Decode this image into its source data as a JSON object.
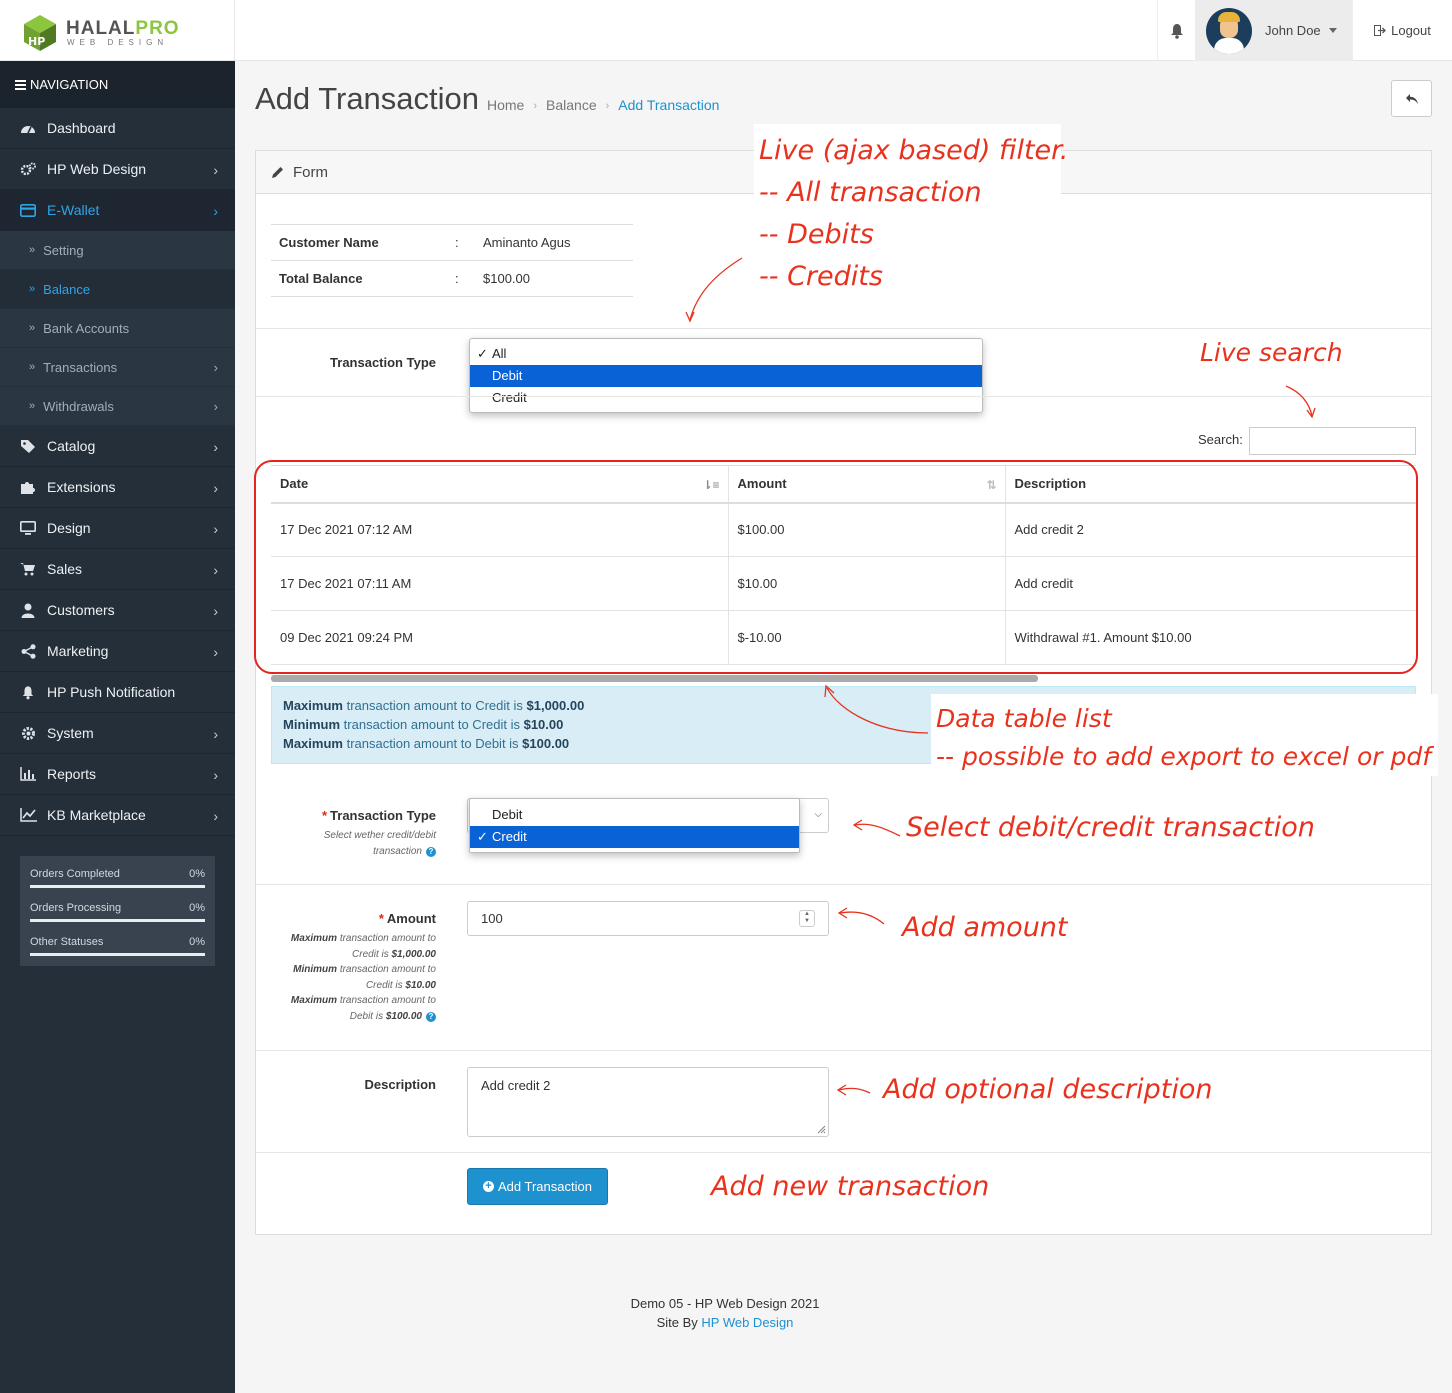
{
  "brand": {
    "name_part1": "HALAL",
    "name_part2": "PRO",
    "tagline": "WEB DESIGN"
  },
  "header": {
    "user_name": "John Doe",
    "logout_label": "Logout"
  },
  "sidebar": {
    "title": "NAVIGATION",
    "items": [
      {
        "label": "Dashboard",
        "icon": "dashboard-icon"
      },
      {
        "label": "HP Web Design",
        "icon": "cogs-icon"
      },
      {
        "label": "E-Wallet",
        "icon": "credit-card-icon"
      },
      {
        "label": "Catalog",
        "icon": "tags-icon"
      },
      {
        "label": "Extensions",
        "icon": "puzzle-icon"
      },
      {
        "label": "Design",
        "icon": "monitor-icon"
      },
      {
        "label": "Sales",
        "icon": "cart-icon"
      },
      {
        "label": "Customers",
        "icon": "user-icon"
      },
      {
        "label": "Marketing",
        "icon": "share-icon"
      },
      {
        "label": "HP Push Notification",
        "icon": "bell-icon"
      },
      {
        "label": "System",
        "icon": "gear-icon"
      },
      {
        "label": "Reports",
        "icon": "bar-chart-icon"
      },
      {
        "label": "KB Marketplace",
        "icon": "line-chart-icon"
      }
    ],
    "ewallet_sub": [
      {
        "label": "Setting"
      },
      {
        "label": "Balance"
      },
      {
        "label": "Bank Accounts"
      },
      {
        "label": "Transactions"
      },
      {
        "label": "Withdrawals"
      }
    ],
    "stats": [
      {
        "label": "Orders Completed",
        "value": "0%"
      },
      {
        "label": "Orders Processing",
        "value": "0%"
      },
      {
        "label": "Other Statuses",
        "value": "0%"
      }
    ]
  },
  "page": {
    "title": "Add Transaction",
    "breadcrumb": [
      "Home",
      "Balance",
      "Add Transaction"
    ],
    "panel_title": "Form"
  },
  "customer": {
    "name_label": "Customer Name",
    "name_value": "Aminanto Agus",
    "balance_label": "Total Balance",
    "balance_value": "$100.00",
    "colon": ":"
  },
  "filter": {
    "label": "Transaction Type",
    "options": [
      "All",
      "Debit",
      "Credit"
    ],
    "checked": "All",
    "highlighted": "Debit"
  },
  "search": {
    "label": "Search:"
  },
  "table": {
    "columns": [
      "Date",
      "Amount",
      "Description"
    ],
    "rows": [
      {
        "date": "17 Dec 2021 07:12 AM",
        "amount": "$100.00",
        "description": "Add credit 2"
      },
      {
        "date": "17 Dec 2021 07:11 AM",
        "amount": "$10.00",
        "description": "Add credit"
      },
      {
        "date": "09 Dec 2021 09:24 PM",
        "amount": "$-10.00",
        "description": "Withdrawal #1. Amount $10.00"
      }
    ]
  },
  "limits": {
    "l1_a": "Maximum",
    "l1_b": " transaction amount to Credit is ",
    "l1_c": "$1,000.00",
    "l2_a": "Minimum",
    "l2_b": " transaction amount to Credit is ",
    "l2_c": "$10.00",
    "l3_a": "Maximum",
    "l3_b": " transaction amount to Debit is ",
    "l3_c": "$100.00"
  },
  "form": {
    "type_label": "Transaction Type",
    "type_help_1": "Select wether credit/debit",
    "type_help_2": "transaction",
    "type_options": [
      "Debit",
      "Credit"
    ],
    "type_selected": "Credit",
    "amount_label": "Amount",
    "amount_value": "100",
    "amount_help": {
      "h1a": "Maximum",
      "h1b": " transaction amount to",
      "h1c": "Credit is ",
      "h1d": "$1,000.00",
      "h2a": "Minimum",
      "h2b": " transaction amount to",
      "h2c": "Credit is ",
      "h2d": "$10.00",
      "h3a": "Maximum",
      "h3b": " transaction amount to",
      "h3c": "Debit is ",
      "h3d": "$100.00"
    },
    "description_label": "Description",
    "description_value": "Add credit 2",
    "submit_label": "Add Transaction",
    "required_mark": "*"
  },
  "footer": {
    "line1": "Demo 05 - HP Web Design 2021",
    "line2_prefix": "Site By ",
    "line2_link": "HP Web Design"
  },
  "annotations": {
    "filter_1": "Live (ajax based) filter.",
    "filter_2": "-- All transaction",
    "filter_3": "-- Debits",
    "filter_4": "-- Credits",
    "search": "Live search",
    "table_1": "Data table list",
    "table_2": "-- possible to add export to excel or pdf",
    "select": "Select debit/credit transaction",
    "amount": "Add amount",
    "description": "Add optional description",
    "submit": "Add new transaction"
  },
  "colors": {
    "sidebar_bg": "#252f3a",
    "accent": "#1e91cf",
    "annotation": "#e8321e",
    "selected_option": "#0a63d6"
  }
}
